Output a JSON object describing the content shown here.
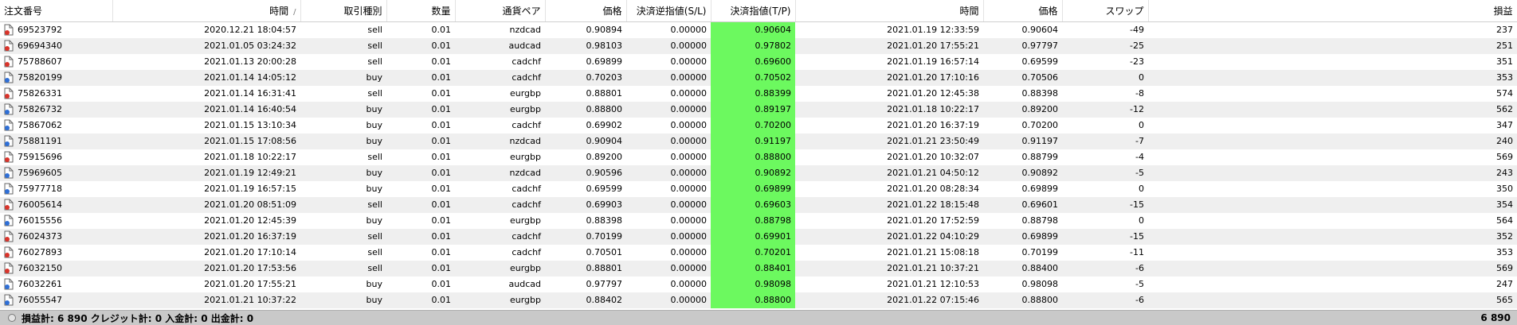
{
  "columns": {
    "ticket": "注文番号",
    "open_time": "時間",
    "type": "取引種別",
    "volume": "数量",
    "symbol": "通貨ペア",
    "open_price": "価格",
    "sl": "決済逆指値(S/L)",
    "tp": "決済指値(T/P)",
    "close_time": "時間",
    "close_price": "価格",
    "swap": "スワップ",
    "profit": "損益"
  },
  "sort_indicator": "/",
  "rows": [
    {
      "ticket": "69523792",
      "open_time": "2020.12.21 18:04:57",
      "type": "sell",
      "volume": "0.01",
      "symbol": "nzdcad",
      "open_price": "0.90894",
      "sl": "0.00000",
      "tp": "0.90604",
      "close_time": "2021.01.19 12:33:59",
      "close_price": "0.90604",
      "swap": "-49",
      "profit": "237"
    },
    {
      "ticket": "69694340",
      "open_time": "2021.01.05 03:24:32",
      "type": "sell",
      "volume": "0.01",
      "symbol": "audcad",
      "open_price": "0.98103",
      "sl": "0.00000",
      "tp": "0.97802",
      "close_time": "2021.01.20 17:55:21",
      "close_price": "0.97797",
      "swap": "-25",
      "profit": "251"
    },
    {
      "ticket": "75788607",
      "open_time": "2021.01.13 20:00:28",
      "type": "sell",
      "volume": "0.01",
      "symbol": "cadchf",
      "open_price": "0.69899",
      "sl": "0.00000",
      "tp": "0.69600",
      "close_time": "2021.01.19 16:57:14",
      "close_price": "0.69599",
      "swap": "-23",
      "profit": "351"
    },
    {
      "ticket": "75820199",
      "open_time": "2021.01.14 14:05:12",
      "type": "buy",
      "volume": "0.01",
      "symbol": "cadchf",
      "open_price": "0.70203",
      "sl": "0.00000",
      "tp": "0.70502",
      "close_time": "2021.01.20 17:10:16",
      "close_price": "0.70506",
      "swap": "0",
      "profit": "353"
    },
    {
      "ticket": "75826331",
      "open_time": "2021.01.14 16:31:41",
      "type": "sell",
      "volume": "0.01",
      "symbol": "eurgbp",
      "open_price": "0.88801",
      "sl": "0.00000",
      "tp": "0.88399",
      "close_time": "2021.01.20 12:45:38",
      "close_price": "0.88398",
      "swap": "-8",
      "profit": "574"
    },
    {
      "ticket": "75826732",
      "open_time": "2021.01.14 16:40:54",
      "type": "buy",
      "volume": "0.01",
      "symbol": "eurgbp",
      "open_price": "0.88800",
      "sl": "0.00000",
      "tp": "0.89197",
      "close_time": "2021.01.18 10:22:17",
      "close_price": "0.89200",
      "swap": "-12",
      "profit": "562"
    },
    {
      "ticket": "75867062",
      "open_time": "2021.01.15 13:10:34",
      "type": "buy",
      "volume": "0.01",
      "symbol": "cadchf",
      "open_price": "0.69902",
      "sl": "0.00000",
      "tp": "0.70200",
      "close_time": "2021.01.20 16:37:19",
      "close_price": "0.70200",
      "swap": "0",
      "profit": "347"
    },
    {
      "ticket": "75881191",
      "open_time": "2021.01.15 17:08:56",
      "type": "buy",
      "volume": "0.01",
      "symbol": "nzdcad",
      "open_price": "0.90904",
      "sl": "0.00000",
      "tp": "0.91197",
      "close_time": "2021.01.21 23:50:49",
      "close_price": "0.91197",
      "swap": "-7",
      "profit": "240"
    },
    {
      "ticket": "75915696",
      "open_time": "2021.01.18 10:22:17",
      "type": "sell",
      "volume": "0.01",
      "symbol": "eurgbp",
      "open_price": "0.89200",
      "sl": "0.00000",
      "tp": "0.88800",
      "close_time": "2021.01.20 10:32:07",
      "close_price": "0.88799",
      "swap": "-4",
      "profit": "569"
    },
    {
      "ticket": "75969605",
      "open_time": "2021.01.19 12:49:21",
      "type": "buy",
      "volume": "0.01",
      "symbol": "nzdcad",
      "open_price": "0.90596",
      "sl": "0.00000",
      "tp": "0.90892",
      "close_time": "2021.01.21 04:50:12",
      "close_price": "0.90892",
      "swap": "-5",
      "profit": "243"
    },
    {
      "ticket": "75977718",
      "open_time": "2021.01.19 16:57:15",
      "type": "buy",
      "volume": "0.01",
      "symbol": "cadchf",
      "open_price": "0.69599",
      "sl": "0.00000",
      "tp": "0.69899",
      "close_time": "2021.01.20 08:28:34",
      "close_price": "0.69899",
      "swap": "0",
      "profit": "350"
    },
    {
      "ticket": "76005614",
      "open_time": "2021.01.20 08:51:09",
      "type": "sell",
      "volume": "0.01",
      "symbol": "cadchf",
      "open_price": "0.69903",
      "sl": "0.00000",
      "tp": "0.69603",
      "close_time": "2021.01.22 18:15:48",
      "close_price": "0.69601",
      "swap": "-15",
      "profit": "354"
    },
    {
      "ticket": "76015556",
      "open_time": "2021.01.20 12:45:39",
      "type": "buy",
      "volume": "0.01",
      "symbol": "eurgbp",
      "open_price": "0.88398",
      "sl": "0.00000",
      "tp": "0.88798",
      "close_time": "2021.01.20 17:52:59",
      "close_price": "0.88798",
      "swap": "0",
      "profit": "564"
    },
    {
      "ticket": "76024373",
      "open_time": "2021.01.20 16:37:19",
      "type": "sell",
      "volume": "0.01",
      "symbol": "cadchf",
      "open_price": "0.70199",
      "sl": "0.00000",
      "tp": "0.69901",
      "close_time": "2021.01.22 04:10:29",
      "close_price": "0.69899",
      "swap": "-15",
      "profit": "352"
    },
    {
      "ticket": "76027893",
      "open_time": "2021.01.20 17:10:14",
      "type": "sell",
      "volume": "0.01",
      "symbol": "cadchf",
      "open_price": "0.70501",
      "sl": "0.00000",
      "tp": "0.70201",
      "close_time": "2021.01.21 15:08:18",
      "close_price": "0.70199",
      "swap": "-11",
      "profit": "353"
    },
    {
      "ticket": "76032150",
      "open_time": "2021.01.20 17:53:56",
      "type": "sell",
      "volume": "0.01",
      "symbol": "eurgbp",
      "open_price": "0.88801",
      "sl": "0.00000",
      "tp": "0.88401",
      "close_time": "2021.01.21 10:37:21",
      "close_price": "0.88400",
      "swap": "-6",
      "profit": "569"
    },
    {
      "ticket": "76032261",
      "open_time": "2021.01.20 17:55:21",
      "type": "buy",
      "volume": "0.01",
      "symbol": "audcad",
      "open_price": "0.97797",
      "sl": "0.00000",
      "tp": "0.98098",
      "close_time": "2021.01.21 12:10:53",
      "close_price": "0.98098",
      "swap": "-5",
      "profit": "247"
    },
    {
      "ticket": "76055547",
      "open_time": "2021.01.21 10:37:22",
      "type": "buy",
      "volume": "0.01",
      "symbol": "eurgbp",
      "open_price": "0.88402",
      "sl": "0.00000",
      "tp": "0.88800",
      "close_time": "2021.01.22 07:15:46",
      "close_price": "0.88800",
      "swap": "-6",
      "profit": "565"
    }
  ],
  "footer": {
    "summary": "損益計: 6 890  クレジット計: 0  入金計: 0  出金計: 0",
    "total": "6 890"
  },
  "colors": {
    "tp_highlight": "#6cf95f",
    "sell_icon": "#d9342b",
    "buy_icon": "#2f6fd6"
  },
  "icons": {
    "sell": "document-sell-icon",
    "buy": "document-buy-icon"
  }
}
